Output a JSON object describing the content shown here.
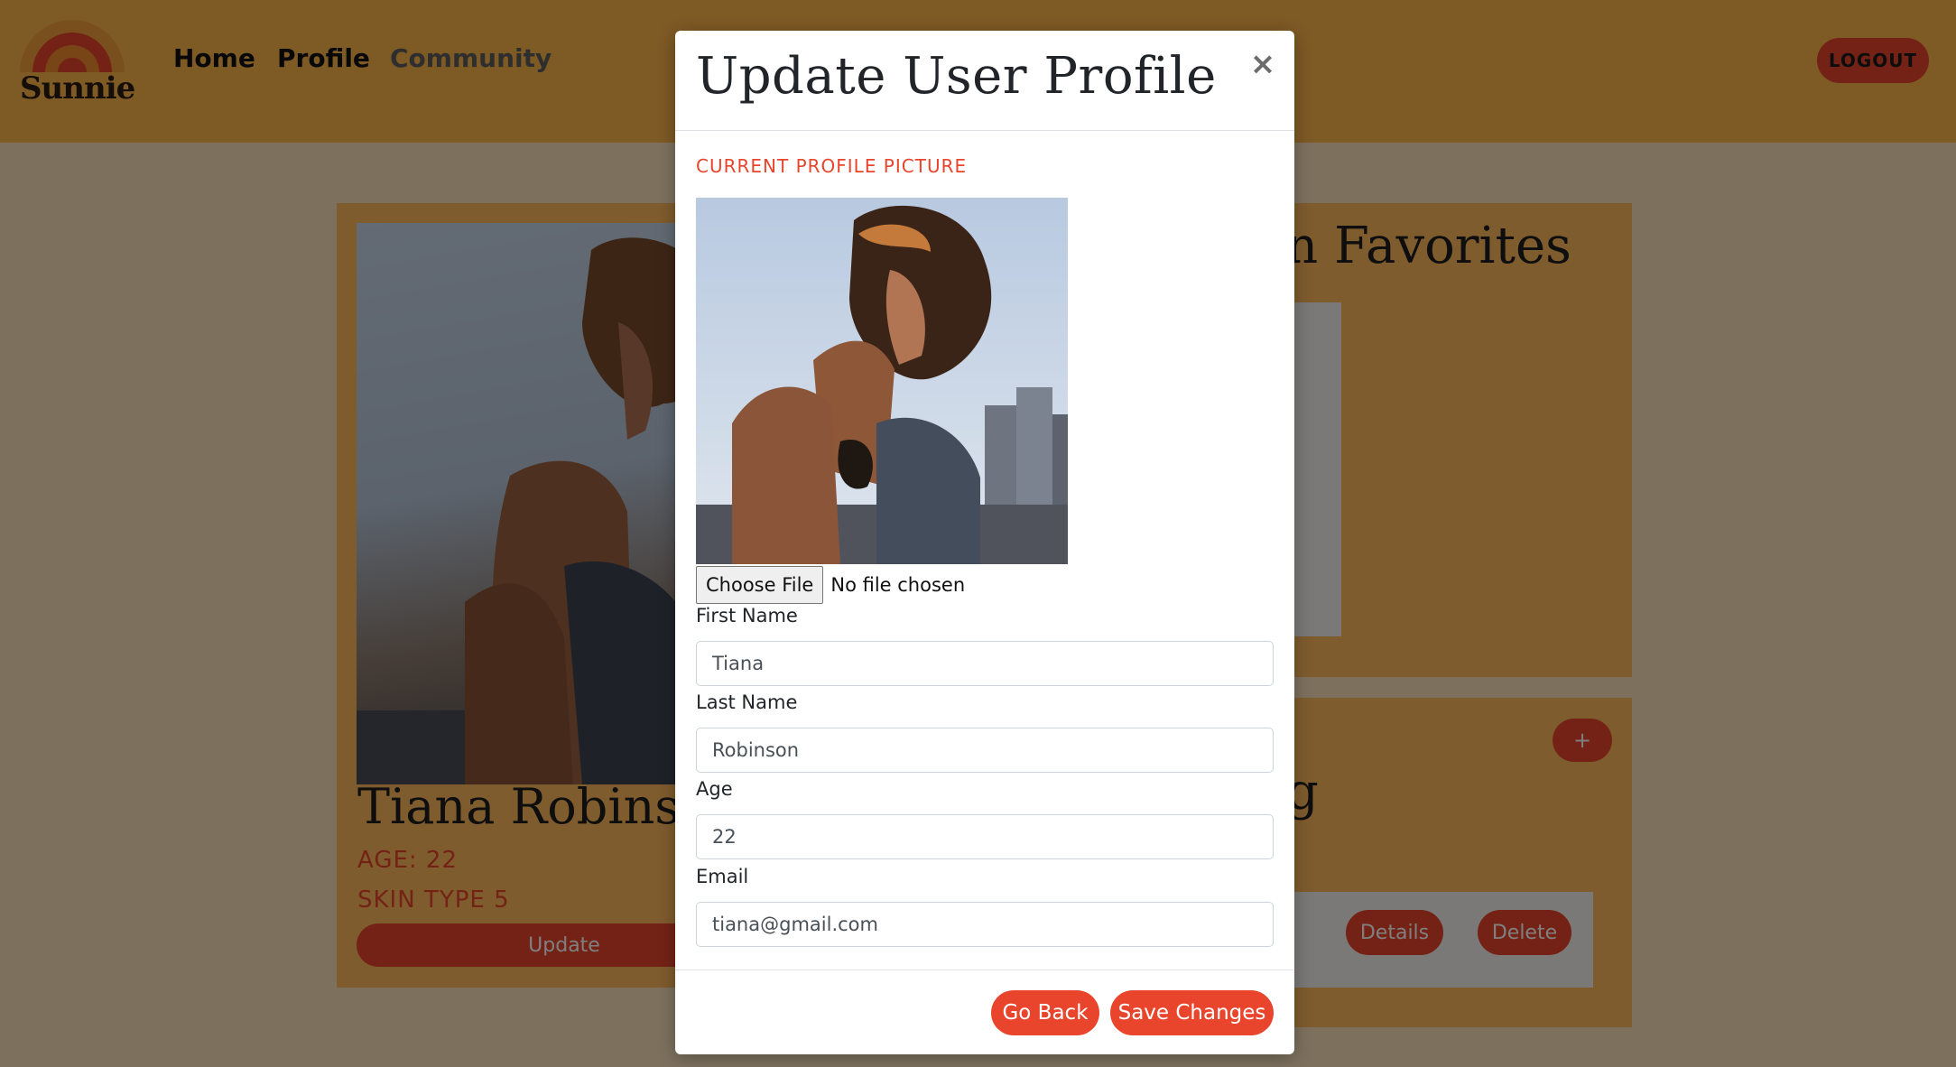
{
  "nav": {
    "logo_text": "Sunnie",
    "links": [
      "Home",
      "Profile",
      "Community"
    ],
    "logout_label": "LOGOUT"
  },
  "background": {
    "profile_name": "Tiana Robinso",
    "age_text": "AGE: 22",
    "skin_type_text": "SKIN TYPE 5",
    "update_label": "Update",
    "favorites_heading": "tion Favorites",
    "routine_heading_fragment": "g",
    "add_label": "+",
    "details_label": "Details",
    "delete_label": "Delete"
  },
  "modal": {
    "title": "Update User Profile",
    "close_symbol": "×",
    "current_picture_label": "CURRENT PROFILE PICTURE",
    "choose_file_label": "Choose File",
    "file_status": "No file chosen",
    "fields": {
      "first_name_label": "First Name",
      "first_name_value": "Tiana",
      "last_name_label": "Last Name",
      "last_name_value": "Robinson",
      "age_label": "Age",
      "age_value": "22",
      "email_label": "Email",
      "email_value": "tiana@gmail.com"
    },
    "go_back_label": "Go Back",
    "save_label": "Save Changes"
  },
  "colors": {
    "accent": "#e8452c",
    "navbar": "#fdb54a",
    "card": "#feb95c"
  }
}
